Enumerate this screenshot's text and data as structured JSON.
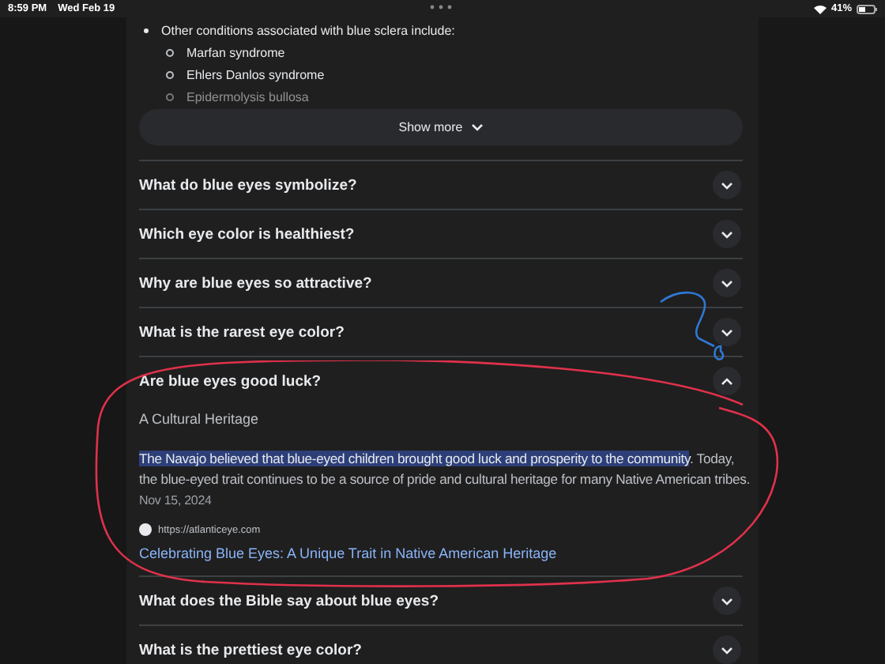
{
  "status_bar": {
    "time": "8:59 PM",
    "date": "Wed Feb 19",
    "battery": "41%"
  },
  "list": {
    "heading": "Other conditions associated with blue sclera include:",
    "items": [
      {
        "text": "Marfan syndrome",
        "faded": false
      },
      {
        "text": "Ehlers Danlos syndrome",
        "faded": false
      },
      {
        "text": "Epidermolysis bullosa",
        "faded": true
      }
    ]
  },
  "show_more": "Show more",
  "questions": [
    {
      "text": "What do blue eyes symbolize?",
      "expanded": false
    },
    {
      "text": "Which eye color is healthiest?",
      "expanded": false
    },
    {
      "text": "Why are blue eyes so attractive?",
      "expanded": false
    },
    {
      "text": "What is the rarest eye color?",
      "expanded": false
    },
    {
      "text": "Are blue eyes good luck?",
      "expanded": true,
      "answer": {
        "heading": "A Cultural Heritage",
        "selected_text": "The Navajo believed that blue-eyed children brought good luck and prosperity to the community",
        "text": ". Today, the blue-eyed trait continues to be a source of pride and cultural heritage for many Native American tribes.",
        "date": "Nov 15, 2024",
        "source_url": "https://atlanticeye.com",
        "link": "Celebrating Blue Eyes: A Unique Trait in Native American Heritage"
      }
    },
    {
      "text": "What does the Bible say about blue eyes?",
      "expanded": false
    },
    {
      "text": "What is the prettiest eye color?",
      "expanded": false
    }
  ]
}
